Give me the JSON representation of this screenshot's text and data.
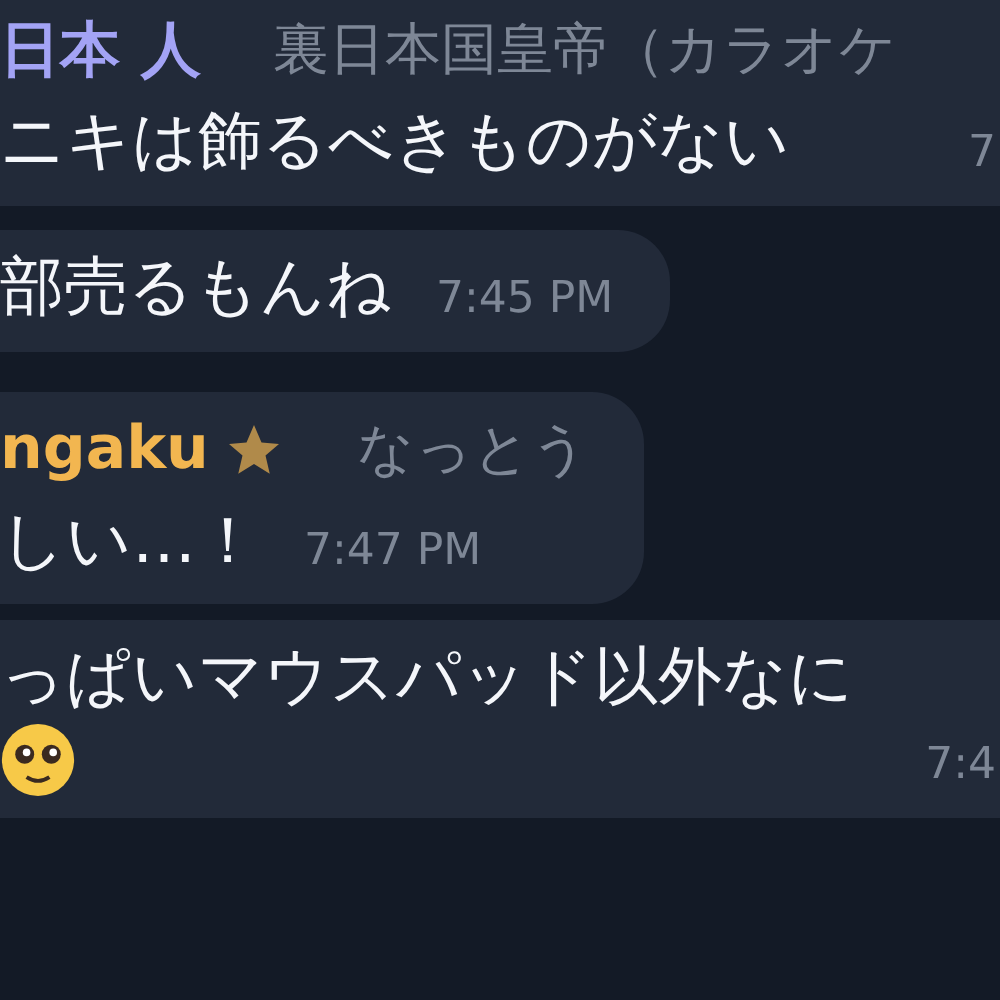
{
  "messages": [
    {
      "kind": "wide",
      "sender": "日本 人",
      "color": "#a3a3f5",
      "sender_title": "裏日本国皇帝（カラオケ",
      "text": "ニキは飾るべきものがない",
      "time": "7"
    },
    {
      "kind": "narrow",
      "text": "部売るもんね",
      "time": "7:45 PM"
    },
    {
      "kind": "narrow",
      "sender": "ngaku",
      "color": "#f2b650",
      "badge": {
        "kind": "star"
      },
      "sender_title": "なっとう",
      "text": "しい…！",
      "time": "7:47 PM"
    },
    {
      "kind": "wide",
      "text": "っぱいマウスパッド以外なに",
      "emoji": {
        "kind": "pleading"
      },
      "time": "7:4"
    }
  ]
}
